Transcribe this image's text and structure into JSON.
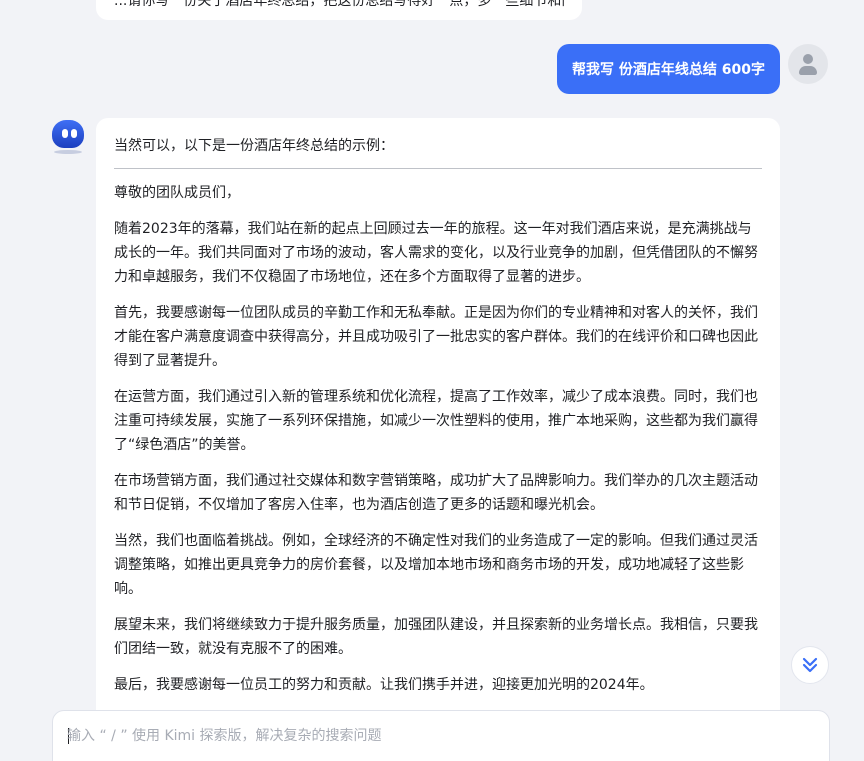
{
  "previous_message": {
    "text": "...请你写一份关于酒店年终总结，把这份总结写得好一点，多一些细节和内容"
  },
  "user_message": {
    "text": "帮我写 份酒店年线总结 600字"
  },
  "assistant_message": {
    "intro": "当然可以，以下是一份酒店年终总结的示例：",
    "paragraphs": [
      "尊敬的团队成员们，",
      "随着2023年的落幕，我们站在新的起点上回顾过去一年的旅程。这一年对我们酒店来说，是充满挑战与成长的一年。我们共同面对了市场的波动，客人需求的变化，以及行业竞争的加剧，但凭借团队的不懈努力和卓越服务，我们不仅稳固了市场地位，还在多个方面取得了显著的进步。",
      "首先，我要感谢每一位团队成员的辛勤工作和无私奉献。正是因为你们的专业精神和对客人的关怀，我们才能在客户满意度调查中获得高分，并且成功吸引了一批忠实的客户群体。我们的在线评价和口碑也因此得到了显著提升。",
      "在运营方面，我们通过引入新的管理系统和优化流程，提高了工作效率，减少了成本浪费。同时，我们也注重可持续发展，实施了一系列环保措施，如减少一次性塑料的使用，推广本地采购，这些都为我们赢得了“绿色酒店”的美誉。",
      "在市场营销方面，我们通过社交媒体和数字营销策略，成功扩大了品牌影响力。我们举办的几次主题活动和节日促销，不仅增加了客房入住率，也为酒店创造了更多的话题和曝光机会。",
      "当然，我们也面临着挑战。例如，全球经济的不确定性对我们的业务造成了一定的影响。但我们通过灵活调整策略，如推出更具竞争力的房价套餐，以及增加本地市场和商务市场的开发，成功地减轻了这些影响。",
      "展望未来，我们将继续致力于提升服务质量，加强团队建设，并且探索新的业务增长点。我相信，只要我们团结一致，就没有克服不了的困难。",
      "最后，我要感谢每一位员工的努力和贡献。让我们携手并进，迎接更加光明的2024年。"
    ]
  },
  "input": {
    "value": "",
    "placeholder": "输入 “ / ” 使用 Kimi 探索版，解决复杂的搜索问题"
  },
  "icons": {
    "user_avatar": "user-avatar-icon",
    "assistant_avatar": "kimi-avatar-icon",
    "scroll_to_bottom": "double-chevron-down-icon"
  },
  "colors": {
    "accent": "#3a6ff7",
    "background": "#f2f3f7",
    "bubble": "#ffffff"
  }
}
